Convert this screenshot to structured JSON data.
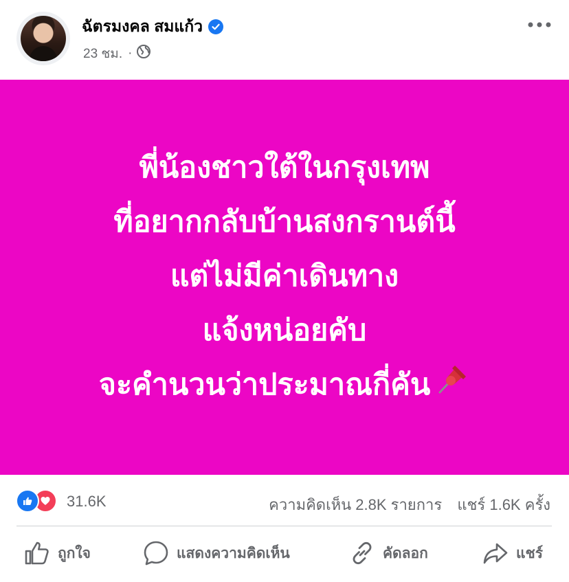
{
  "post": {
    "author": "ฉัตรมงคล สมแก้ว",
    "verified": true,
    "time": "23 ชม.",
    "separator": "·",
    "privacy_icon": "globe-icon",
    "more_icon": "more-dots-icon"
  },
  "image": {
    "background_color": "#ec06c5",
    "lines": [
      "พี่น้องชาวใต้ในกรุงเทพ",
      "ที่อยากกลับบ้านสงกรานต์นี้",
      "แต่ไม่มีค่าเดินทาง",
      "แจ้งหน่อยคับ",
      "จะคำนวนว่าประมาณกี่คัน"
    ],
    "emoji_icon": "pushpin-icon"
  },
  "stats": {
    "reactions": "31.6K",
    "comments": "ความคิดเห็น 2.8K รายการ",
    "shares": "แชร์ 1.6K ครั้ง"
  },
  "actions": {
    "like": "ถูกใจ",
    "comment": "แสดงความคิดเห็น",
    "copy": "คัดลอก",
    "share": "แชร์"
  },
  "colors": {
    "accent": "#1877f2",
    "love": "#f33e58",
    "secondary_text": "#65676b"
  }
}
